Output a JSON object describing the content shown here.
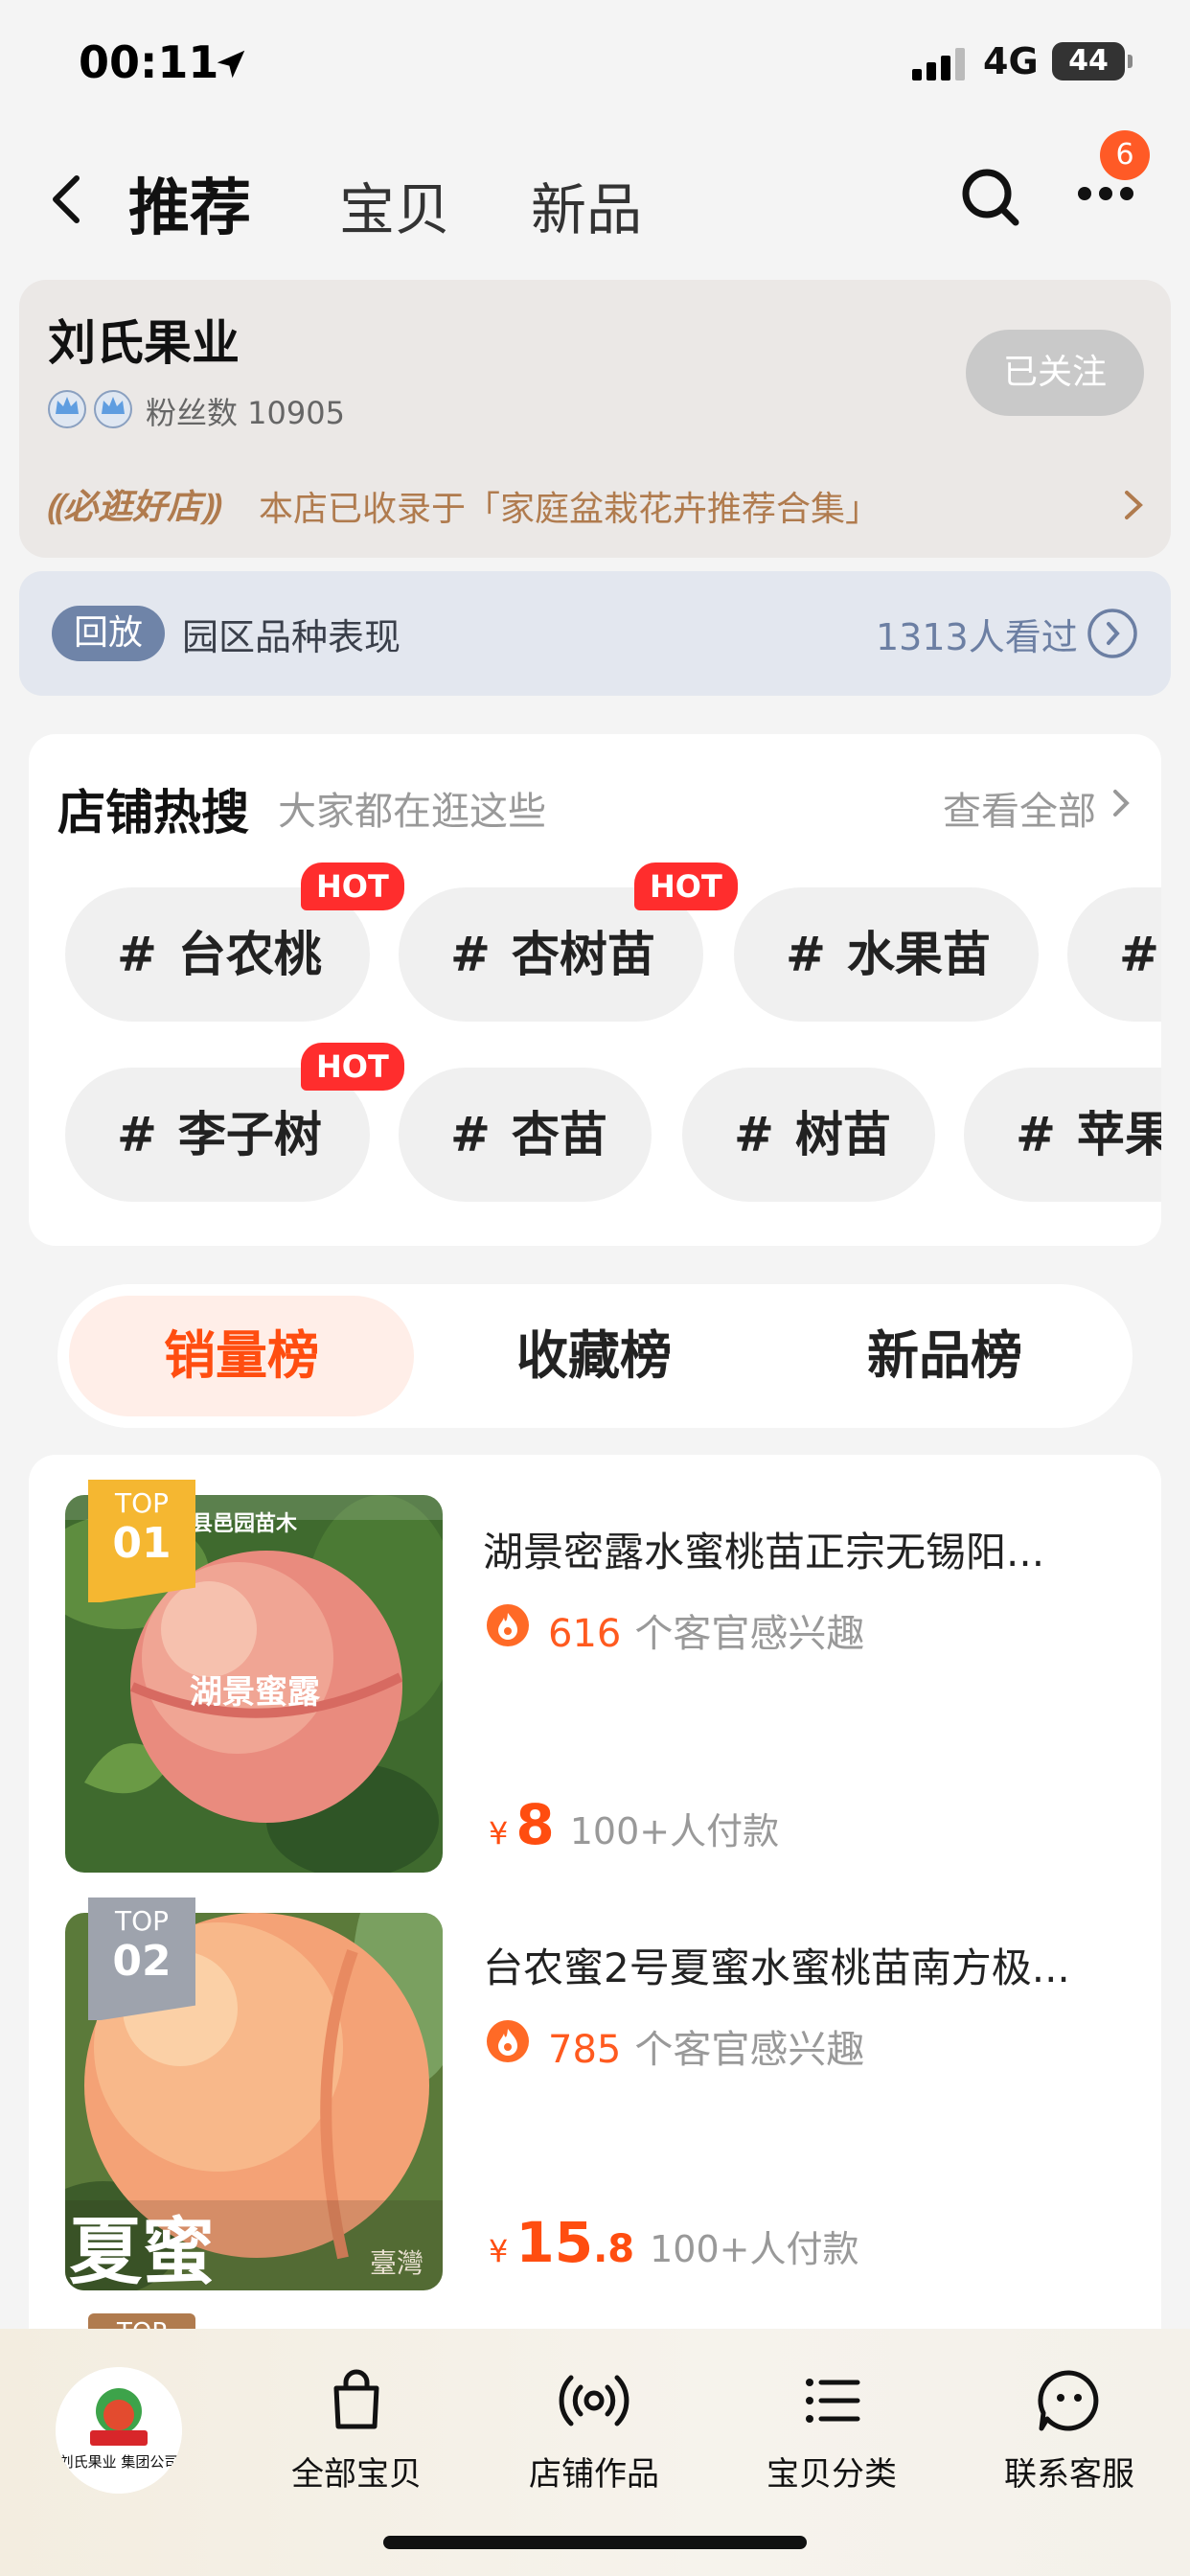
{
  "status_bar": {
    "time": "00:11",
    "network": "4G",
    "battery": "44"
  },
  "header": {
    "tabs": [
      {
        "label": "推荐",
        "active": true
      },
      {
        "label": "宝贝",
        "active": false
      },
      {
        "label": "新品",
        "active": false
      }
    ],
    "more_badge": "6"
  },
  "store": {
    "name": "刘氏果业",
    "fans_label": "粉丝数 10905",
    "follow_label": "已关注",
    "must_shop_label": "必逛好店",
    "must_shop_desc": "本店已收录于「家庭盆栽花卉推荐合集」"
  },
  "replay": {
    "tag": "回放",
    "title": "园区品种表现",
    "views": "1313人看过"
  },
  "hot_search": {
    "title": "店铺热搜",
    "subtitle": "大家都在逛这些",
    "view_all": "查看全部",
    "hot_badge_label": "HOT",
    "row1": [
      {
        "label": "台农桃",
        "hot": true
      },
      {
        "label": "杏树苗",
        "hot": true
      },
      {
        "label": "水果苗",
        "hot": false
      },
      {
        "label": "",
        "hot": false
      }
    ],
    "row2": [
      {
        "label": "李子树",
        "hot": true
      },
      {
        "label": "杏苗",
        "hot": false
      },
      {
        "label": "树苗",
        "hot": false
      },
      {
        "label": "苹果",
        "hot": false
      }
    ]
  },
  "ranking_tabs": [
    {
      "label": "销量榜",
      "active": true
    },
    {
      "label": "收藏榜",
      "active": false
    },
    {
      "label": "新品榜",
      "active": false
    }
  ],
  "products": [
    {
      "rank_top": "TOP",
      "rank_num": "01",
      "title": "湖景密露水蜜桃苗正宗无锡阳...",
      "interest_count": "616",
      "interest_text": "个客官感兴趣",
      "price_symbol": "¥",
      "price": "8",
      "paid": "100+人付款",
      "image_text": "湖景蜜露",
      "image_banner": "县邑园苗木",
      "tag_color": "#f5b731"
    },
    {
      "rank_top": "TOP",
      "rank_num": "02",
      "title": "台农蜜2号夏蜜水蜜桃苗南方极...",
      "interest_count": "785",
      "interest_text": "个客官感兴趣",
      "price_symbol": "¥",
      "price_int": "15",
      "price_dec": ".8",
      "paid": "100+人付款",
      "image_text": "夏蜜",
      "image_corner": "臺灣",
      "tag_color": "#9ea3ad"
    }
  ],
  "third_tag": "TOP",
  "bottom_nav": {
    "logo_text": "刘氏果业 集团公司",
    "items": [
      {
        "label": "全部宝贝",
        "icon": "bag-icon"
      },
      {
        "label": "店铺作品",
        "icon": "broadcast-icon"
      },
      {
        "label": "宝贝分类",
        "icon": "list-icon"
      },
      {
        "label": "联系客服",
        "icon": "chat-face-icon"
      }
    ]
  }
}
